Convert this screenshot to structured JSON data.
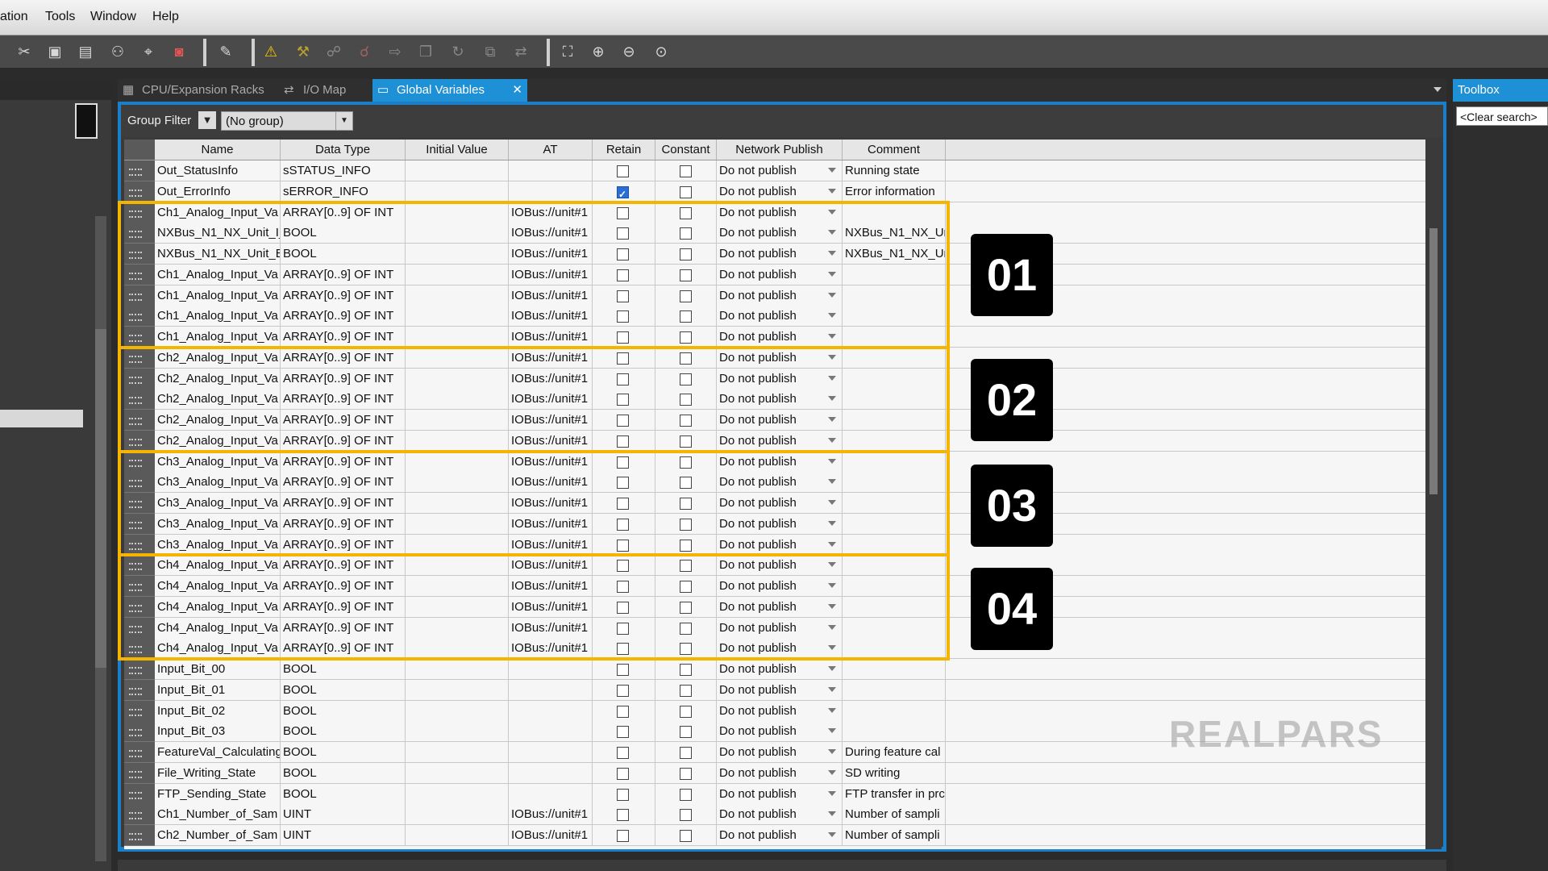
{
  "menu": [
    "ation",
    "Tools",
    "Window",
    "Help"
  ],
  "tabs": [
    {
      "label": "CPU/Expansion Racks",
      "icon": "rack-icon"
    },
    {
      "label": "I/O Map",
      "icon": "io-map-icon"
    },
    {
      "label": "Global Variables",
      "icon": "variables-icon",
      "active": true,
      "close": "✕"
    }
  ],
  "group_filter": {
    "label": "Group Filter",
    "value": "(No group)"
  },
  "toolbox": {
    "title": "Toolbox",
    "search_placeholder": "<Clear search>"
  },
  "columns": [
    "Name",
    "Data Type",
    "Initial Value",
    "AT",
    "Retain",
    "Constant",
    "Network Publish",
    "Comment"
  ],
  "rows": [
    {
      "name": "Out_StatusInfo",
      "type": "sSTATUS_INFO",
      "init": "",
      "at": "",
      "retain": false,
      "const": false,
      "publish": "Do not publish",
      "comment": "Running state"
    },
    {
      "name": "Out_ErrorInfo",
      "type": "sERROR_INFO",
      "init": "",
      "at": "",
      "retain": true,
      "const": false,
      "publish": "Do not publish",
      "comment": "Error information"
    },
    {
      "name": "Ch1_Analog_Input_Va",
      "type": "ARRAY[0..9] OF INT",
      "init": "",
      "at": "IOBus://unit#1",
      "retain": false,
      "const": false,
      "publish": "Do not publish",
      "comment": ""
    },
    {
      "name": "NXBus_N1_NX_Unit_I_",
      "type": "BOOL",
      "init": "",
      "at": "IOBus://unit#1",
      "retain": false,
      "const": false,
      "publish": "Do not publish",
      "comment": "NXBus_N1_NX_Un"
    },
    {
      "name": "NXBus_N1_NX_Unit_E",
      "type": "BOOL",
      "init": "",
      "at": "IOBus://unit#1",
      "retain": false,
      "const": false,
      "publish": "Do not publish",
      "comment": "NXBus_N1_NX_Un"
    },
    {
      "name": "Ch1_Analog_Input_Va",
      "type": "ARRAY[0..9] OF INT",
      "init": "",
      "at": "IOBus://unit#1",
      "retain": false,
      "const": false,
      "publish": "Do not publish",
      "comment": ""
    },
    {
      "name": "Ch1_Analog_Input_Va",
      "type": "ARRAY[0..9] OF INT",
      "init": "",
      "at": "IOBus://unit#1",
      "retain": false,
      "const": false,
      "publish": "Do not publish",
      "comment": ""
    },
    {
      "name": "Ch1_Analog_Input_Va",
      "type": "ARRAY[0..9] OF INT",
      "init": "",
      "at": "IOBus://unit#1",
      "retain": false,
      "const": false,
      "publish": "Do not publish",
      "comment": ""
    },
    {
      "name": "Ch1_Analog_Input_Va",
      "type": "ARRAY[0..9] OF INT",
      "init": "",
      "at": "IOBus://unit#1",
      "retain": false,
      "const": false,
      "publish": "Do not publish",
      "comment": ""
    },
    {
      "name": "Ch2_Analog_Input_Va",
      "type": "ARRAY[0..9] OF INT",
      "init": "",
      "at": "IOBus://unit#1",
      "retain": false,
      "const": false,
      "publish": "Do not publish",
      "comment": ""
    },
    {
      "name": "Ch2_Analog_Input_Va",
      "type": "ARRAY[0..9] OF INT",
      "init": "",
      "at": "IOBus://unit#1",
      "retain": false,
      "const": false,
      "publish": "Do not publish",
      "comment": ""
    },
    {
      "name": "Ch2_Analog_Input_Va",
      "type": "ARRAY[0..9] OF INT",
      "init": "",
      "at": "IOBus://unit#1",
      "retain": false,
      "const": false,
      "publish": "Do not publish",
      "comment": ""
    },
    {
      "name": "Ch2_Analog_Input_Va",
      "type": "ARRAY[0..9] OF INT",
      "init": "",
      "at": "IOBus://unit#1",
      "retain": false,
      "const": false,
      "publish": "Do not publish",
      "comment": ""
    },
    {
      "name": "Ch2_Analog_Input_Va",
      "type": "ARRAY[0..9] OF INT",
      "init": "",
      "at": "IOBus://unit#1",
      "retain": false,
      "const": false,
      "publish": "Do not publish",
      "comment": ""
    },
    {
      "name": "Ch3_Analog_Input_Va",
      "type": "ARRAY[0..9] OF INT",
      "init": "",
      "at": "IOBus://unit#1",
      "retain": false,
      "const": false,
      "publish": "Do not publish",
      "comment": ""
    },
    {
      "name": "Ch3_Analog_Input_Va",
      "type": "ARRAY[0..9] OF INT",
      "init": "",
      "at": "IOBus://unit#1",
      "retain": false,
      "const": false,
      "publish": "Do not publish",
      "comment": ""
    },
    {
      "name": "Ch3_Analog_Input_Va",
      "type": "ARRAY[0..9] OF INT",
      "init": "",
      "at": "IOBus://unit#1",
      "retain": false,
      "const": false,
      "publish": "Do not publish",
      "comment": ""
    },
    {
      "name": "Ch3_Analog_Input_Va",
      "type": "ARRAY[0..9] OF INT",
      "init": "",
      "at": "IOBus://unit#1",
      "retain": false,
      "const": false,
      "publish": "Do not publish",
      "comment": ""
    },
    {
      "name": "Ch3_Analog_Input_Va",
      "type": "ARRAY[0..9] OF INT",
      "init": "",
      "at": "IOBus://unit#1",
      "retain": false,
      "const": false,
      "publish": "Do not publish",
      "comment": ""
    },
    {
      "name": "Ch4_Analog_Input_Va",
      "type": "ARRAY[0..9] OF INT",
      "init": "",
      "at": "IOBus://unit#1",
      "retain": false,
      "const": false,
      "publish": "Do not publish",
      "comment": ""
    },
    {
      "name": "Ch4_Analog_Input_Va",
      "type": "ARRAY[0..9] OF INT",
      "init": "",
      "at": "IOBus://unit#1",
      "retain": false,
      "const": false,
      "publish": "Do not publish",
      "comment": ""
    },
    {
      "name": "Ch4_Analog_Input_Va",
      "type": "ARRAY[0..9] OF INT",
      "init": "",
      "at": "IOBus://unit#1",
      "retain": false,
      "const": false,
      "publish": "Do not publish",
      "comment": ""
    },
    {
      "name": "Ch4_Analog_Input_Va",
      "type": "ARRAY[0..9] OF INT",
      "init": "",
      "at": "IOBus://unit#1",
      "retain": false,
      "const": false,
      "publish": "Do not publish",
      "comment": ""
    },
    {
      "name": "Ch4_Analog_Input_Va",
      "type": "ARRAY[0..9] OF INT",
      "init": "",
      "at": "IOBus://unit#1",
      "retain": false,
      "const": false,
      "publish": "Do not publish",
      "comment": ""
    },
    {
      "name": "Input_Bit_00",
      "type": "BOOL",
      "init": "",
      "at": "",
      "retain": false,
      "const": false,
      "publish": "Do not publish",
      "comment": ""
    },
    {
      "name": "Input_Bit_01",
      "type": "BOOL",
      "init": "",
      "at": "",
      "retain": false,
      "const": false,
      "publish": "Do not publish",
      "comment": ""
    },
    {
      "name": "Input_Bit_02",
      "type": "BOOL",
      "init": "",
      "at": "",
      "retain": false,
      "const": false,
      "publish": "Do not publish",
      "comment": ""
    },
    {
      "name": "Input_Bit_03",
      "type": "BOOL",
      "init": "",
      "at": "",
      "retain": false,
      "const": false,
      "publish": "Do not publish",
      "comment": ""
    },
    {
      "name": "FeatureVal_Calculating",
      "type": "BOOL",
      "init": "",
      "at": "",
      "retain": false,
      "const": false,
      "publish": "Do not publish",
      "comment": "During feature cal"
    },
    {
      "name": "File_Writing_State",
      "type": "BOOL",
      "init": "",
      "at": "",
      "retain": false,
      "const": false,
      "publish": "Do not publish",
      "comment": "SD writing"
    },
    {
      "name": "FTP_Sending_State",
      "type": "BOOL",
      "init": "",
      "at": "",
      "retain": false,
      "const": false,
      "publish": "Do not publish",
      "comment": "FTP transfer in prc"
    },
    {
      "name": "Ch1_Number_of_Sam",
      "type": "UINT",
      "init": "",
      "at": "IOBus://unit#1",
      "retain": false,
      "const": false,
      "publish": "Do not publish",
      "comment": "Number of sampli"
    },
    {
      "name": "Ch2_Number_of_Sam",
      "type": "UINT",
      "init": "",
      "at": "IOBus://unit#1",
      "retain": false,
      "const": false,
      "publish": "Do not publish",
      "comment": "Number of sampli"
    }
  ],
  "annotations": [
    {
      "label": "01",
      "first_row": 2,
      "last_row": 8
    },
    {
      "label": "02",
      "first_row": 9,
      "last_row": 13
    },
    {
      "label": "03",
      "first_row": 14,
      "last_row": 18
    },
    {
      "label": "04",
      "first_row": 19,
      "last_row": 23
    }
  ],
  "highlight_color": "#f4b400",
  "watermark": "REALPARS"
}
